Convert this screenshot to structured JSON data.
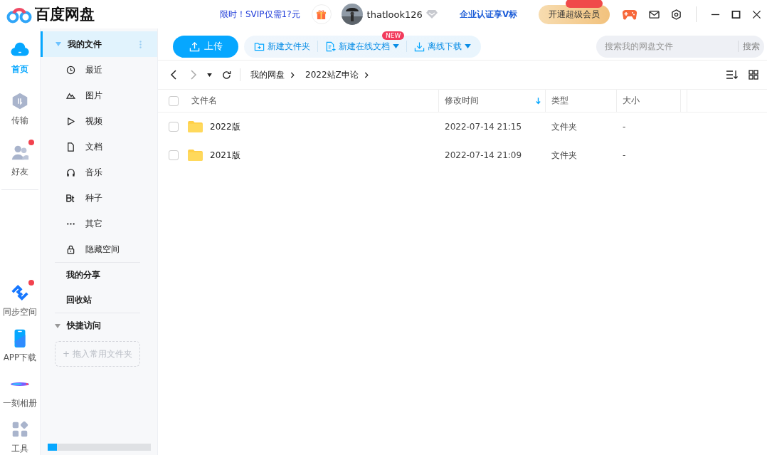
{
  "header": {
    "logo_text": "百度网盘",
    "promo": "限时！SVIP仅需1?元",
    "username": "thatlook126",
    "enterprise_link": "企业认证享V标",
    "vip_button": "开通超级会员"
  },
  "rail": [
    {
      "label": "首页",
      "kind": "home",
      "selected": true,
      "badge": false
    },
    {
      "label": "传输",
      "kind": "transfer",
      "selected": false,
      "badge": false
    },
    {
      "label": "好友",
      "kind": "friends",
      "selected": false,
      "badge": true
    },
    {
      "label": "同步空间",
      "kind": "sync",
      "selected": false,
      "badge": true
    },
    {
      "label": "APP下载",
      "kind": "app",
      "selected": false,
      "badge": false
    },
    {
      "label": "一刻相册",
      "kind": "album",
      "selected": false,
      "badge": false
    },
    {
      "label": "工具",
      "kind": "tools",
      "selected": false,
      "badge": false
    }
  ],
  "sidebar": {
    "root": {
      "label": "我的文件",
      "expanded": true,
      "selected": true
    },
    "items": [
      {
        "label": "最近",
        "kind": "recent"
      },
      {
        "label": "图片"
      },
      {
        "label": "视频",
        "kind": "video"
      },
      {
        "label": "文档",
        "kind": "doc"
      },
      {
        "label": "音乐",
        "kind": "music"
      },
      {
        "label": "种子",
        "kind": "bt"
      },
      {
        "label": "其它",
        "kind": "other"
      },
      {
        "label": "隐藏空间",
        "kind": "lock"
      }
    ],
    "links": [
      "我的分享",
      "回收站"
    ],
    "quick_access": {
      "label": "快捷访问",
      "expanded": true,
      "drop_hint": "+ 拖入常用文件夹"
    },
    "storage": {
      "level": 0.09
    }
  },
  "toolbar": {
    "upload": "上传",
    "actions": [
      {
        "label": "新建文件夹",
        "kind": "folder",
        "dropdown": false
      },
      {
        "label": "新建在线文档",
        "kind": "doc",
        "dropdown": true,
        "badge": "NEW"
      },
      {
        "label": "离线下载",
        "kind": "download",
        "dropdown": true
      }
    ],
    "search": {
      "placeholder": "搜索我的网盘文件",
      "button": "搜索"
    }
  },
  "breadcrumb": [
    "我的网盘",
    "2022站Z申论"
  ],
  "table": {
    "select_all_checked": false,
    "columns": [
      {
        "label": "文件名",
        "sorted": false
      },
      {
        "label": "修改时间",
        "sorted": true
      },
      {
        "label": "类型",
        "sorted": false
      },
      {
        "label": "大小",
        "sorted": false
      }
    ],
    "rows": [
      {
        "name": "2022版",
        "modified": "2022-07-14 21:15",
        "type": "文件夹",
        "size": "-",
        "checked": false
      },
      {
        "name": "2021版",
        "modified": "2022-07-14 21:09",
        "type": "文件夹",
        "size": "-",
        "checked": false
      }
    ]
  }
}
